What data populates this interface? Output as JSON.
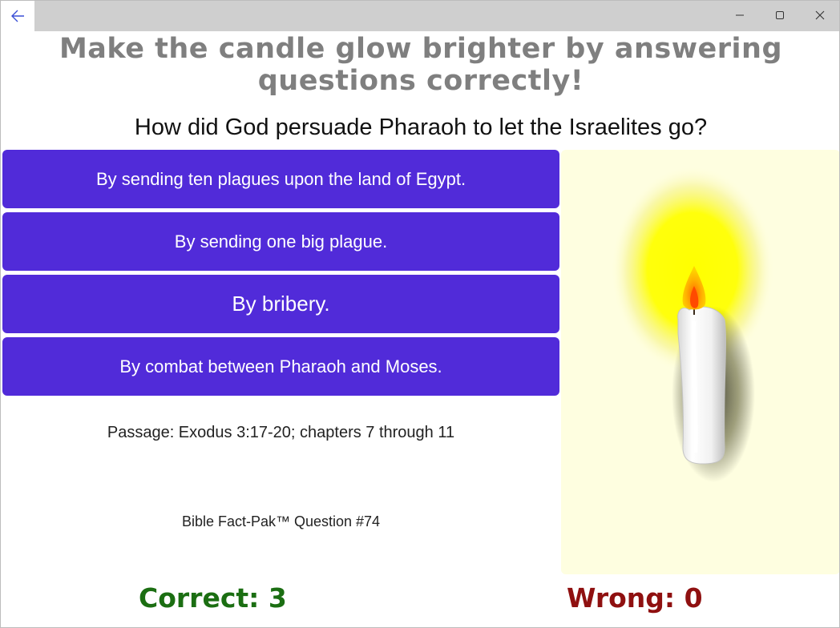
{
  "window": {
    "controls": {
      "back_icon": "arrow-left-icon",
      "minimize_icon": "minimize-icon",
      "maximize_icon": "maximize-icon",
      "close_icon": "close-icon"
    }
  },
  "heading": "Make the candle glow brighter by answering questions correctly!",
  "question": "How did God persuade Pharaoh to let the Israelites go?",
  "answers": [
    "By sending ten plagues upon the land of Egypt.",
    "By sending one big plague.",
    "By bribery.",
    "By combat between Pharaoh and Moses."
  ],
  "passage": "Passage: Exodus 3:17-20; chapters 7 through 11",
  "fact_pak": "Bible Fact-Pak™ Question #74",
  "score": {
    "correct_label": "Correct: 3",
    "wrong_label": "Wrong: 0"
  },
  "colors": {
    "answer_bg": "#512bd9",
    "heading": "#7f7f7f",
    "correct": "#1b6e12",
    "wrong": "#8f1010",
    "candle_panel_bg": "#fefee0",
    "glow": "#ffff00"
  }
}
